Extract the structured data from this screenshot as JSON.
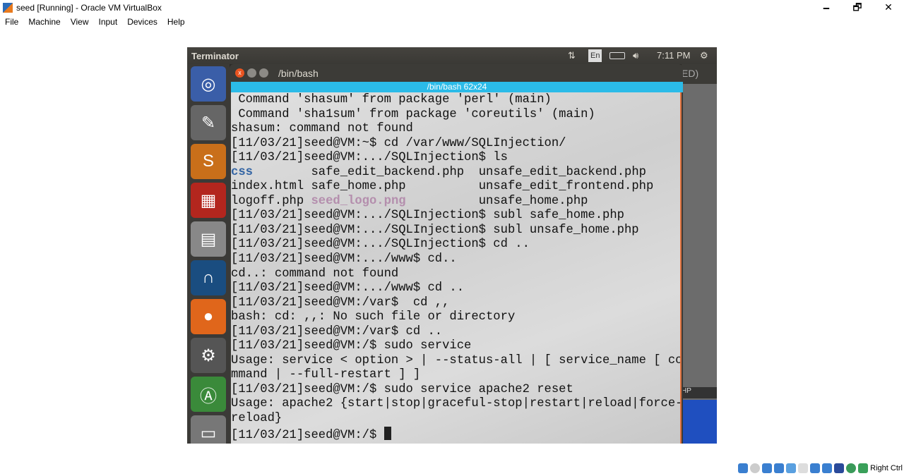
{
  "window": {
    "title": "seed [Running] - Oracle VM VirtualBox",
    "minimize": "🗕",
    "restore": "🗗",
    "close": "✕"
  },
  "menu": [
    "File",
    "Machine",
    "View",
    "Input",
    "Devices",
    "Help"
  ],
  "panel": {
    "app": "Terminator",
    "lang": "En",
    "time": "7:11 PM"
  },
  "terminal": {
    "title": "/bin/bash",
    "tab": "/bin/bash 62x24",
    "bg_fragment": "ED)",
    "bg_fragment2": "HP",
    "lines": [
      " Command 'shasum' from package 'perl' (main)",
      " Command 'sha1sum' from package 'coreutils' (main)",
      "shasum: command not found",
      "[11/03/21]seed@VM:~$ cd /var/www/SQLInjection/",
      "[11/03/21]seed@VM:.../SQLInjection$ ls"
    ],
    "ls": [
      [
        "css",
        "safe_edit_backend.php",
        "unsafe_edit_backend.php"
      ],
      [
        "index.html",
        "safe_home.php",
        "unsafe_edit_frontend.php"
      ],
      [
        "logoff.php",
        "seed_logo.png",
        "unsafe_home.php"
      ]
    ],
    "lines2": [
      "[11/03/21]seed@VM:.../SQLInjection$ subl safe_home.php",
      "[11/03/21]seed@VM:.../SQLInjection$ subl unsafe_home.php",
      "[11/03/21]seed@VM:.../SQLInjection$ cd ..",
      "[11/03/21]seed@VM:.../www$ cd..",
      "cd..: command not found",
      "[11/03/21]seed@VM:.../www$ cd ..",
      "[11/03/21]seed@VM:/var$  cd ,,",
      "bash: cd: ,,: No such file or directory",
      "[11/03/21]seed@VM:/var$ cd ..",
      "[11/03/21]seed@VM:/$ sudo service",
      "Usage: service < option > | --status-all | [ service_name [ co",
      "mmand | --full-restart ] ]",
      "[11/03/21]seed@VM:/$ sudo service apache2 reset",
      "Usage: apache2 {start|stop|graceful-stop|restart|reload|force-",
      "reload}"
    ],
    "prompt": "[11/03/21]seed@VM:/$ "
  },
  "statusbar": {
    "host_key": "Right Ctrl"
  }
}
